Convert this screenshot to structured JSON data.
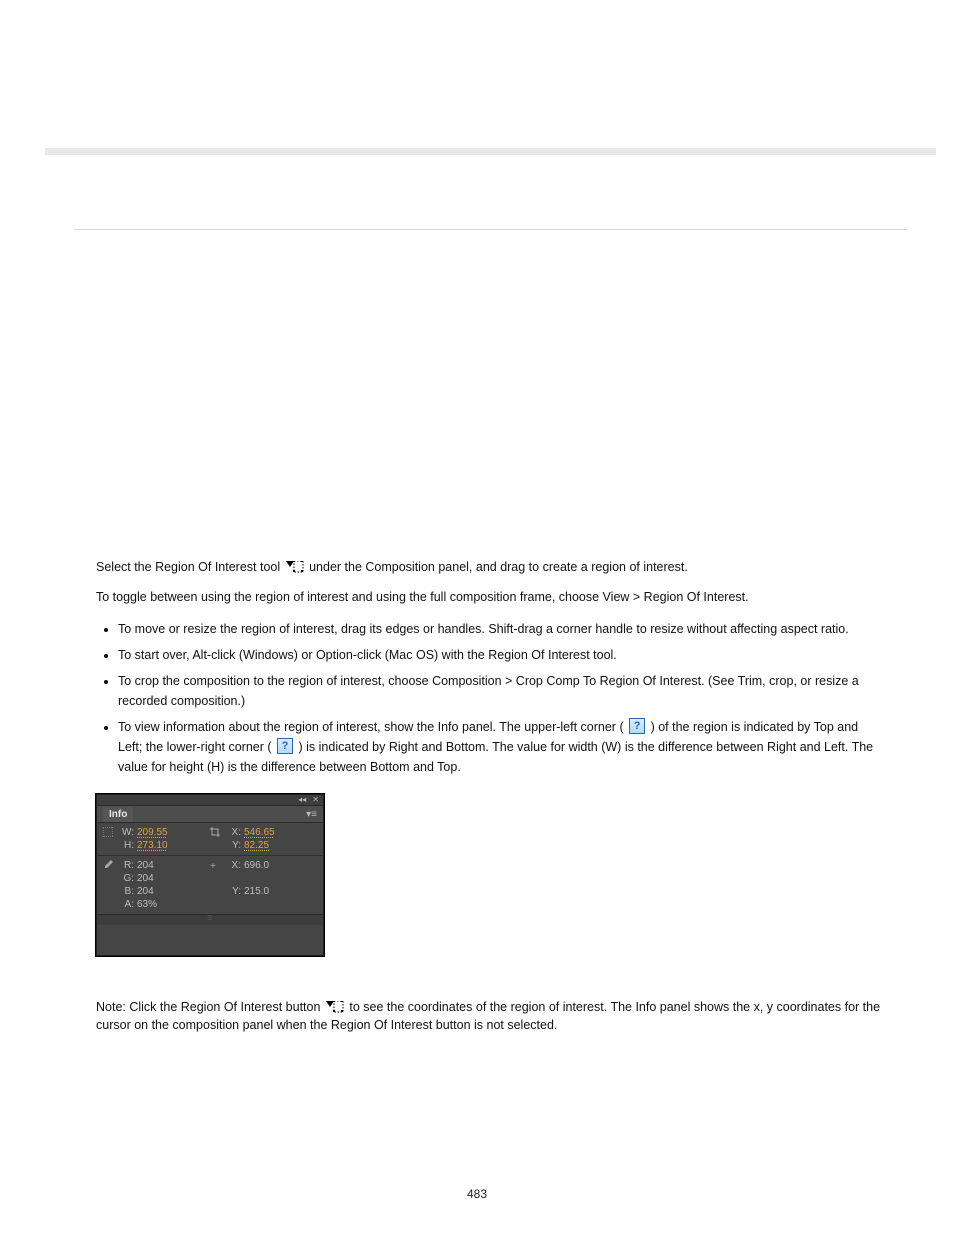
{
  "pageNumber": "483",
  "para1_pre": "Select the Region Of Interest tool ",
  "para1_post": " under the Composition panel, and drag to create a region of interest.",
  "bullets_intro": "To toggle between using the region of interest and using the full composition frame, choose View > Region Of Interest.",
  "bullets": [
    {
      "text": "To move or resize the region of interest, drag its edges or handles. Shift-drag a corner handle to resize without affecting aspect ratio."
    },
    {
      "text": "To start over, Alt-click (Windows) or Option-click (Mac OS) with the Region Of Interest tool."
    },
    {
      "text": "To crop the composition to the region of interest, choose Composition > Crop Comp To Region Of Interest. (See Trim, crop, or resize a recorded composition.)"
    },
    {
      "text_pre": "To view information about the region of interest, show the Info panel. The upper-left corner (",
      "text_mid": ") of the region is indicated by Top and Left; the lower-right corner (",
      "text_post": ") is indicated by Right and Bottom. The value for width (W) is the difference between Right and Left. The value for height (H) is the difference between Bottom and Top."
    }
  ],
  "para2_pre": "Note: Click the Region Of Interest button ",
  "para2_post": " to see the coordinates of the region of interest. The Info panel shows the x, y coordinates for the cursor on the composition panel when the Region Of Interest button is not selected.",
  "infoPanel": {
    "tab": "Info",
    "top": {
      "left": {
        "W": "209.55",
        "H": "273.10"
      },
      "right": {
        "X": "546.65",
        "Y": "82.25"
      }
    },
    "bottom": {
      "left": {
        "R": "204",
        "G": "204",
        "B": "204",
        "A": "63%"
      },
      "right": {
        "X": "696.0",
        "Y": "215.0"
      }
    }
  }
}
